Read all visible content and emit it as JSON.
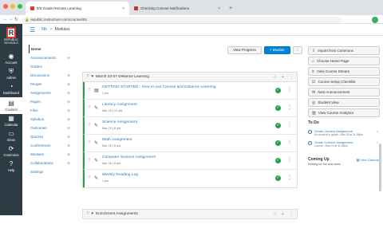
{
  "browser": {
    "tabs": [
      {
        "label": "8/3 Grade Remote Learning",
        "active": true
      },
      {
        "label": "Checking Canvas Notifications",
        "active": false
      }
    ],
    "url": "republic.instructure.com/courses/61"
  },
  "global_nav": {
    "logo_text": "REPUBLIC SCHOOLS",
    "items": [
      {
        "label": "Account",
        "icon": "user-icon"
      },
      {
        "label": "Admin",
        "icon": "shield-icon"
      },
      {
        "label": "Dashboard",
        "icon": "dashboard-icon"
      },
      {
        "label": "Courses",
        "icon": "book-icon",
        "active": true
      },
      {
        "label": "Calendar",
        "icon": "calendar-icon"
      },
      {
        "label": "Inbox",
        "icon": "inbox-icon"
      },
      {
        "label": "Commons",
        "icon": "commons-icon"
      },
      {
        "label": "Help",
        "icon": "help-icon"
      }
    ]
  },
  "breadcrumb": {
    "course": "5th",
    "separator": ">",
    "current": "Modules"
  },
  "course_nav": [
    {
      "label": "Home",
      "active": true
    },
    {
      "label": "Announcements",
      "hidden": true
    },
    {
      "label": "Grades"
    },
    {
      "label": "Discussions",
      "hidden": true
    },
    {
      "label": "People",
      "hidden": true
    },
    {
      "label": "Assignments",
      "hidden": true
    },
    {
      "label": "Pages",
      "hidden": true
    },
    {
      "label": "Files",
      "hidden": true
    },
    {
      "label": "Syllabus",
      "hidden": true
    },
    {
      "label": "Outcomes",
      "hidden": true
    },
    {
      "label": "Quizzes",
      "hidden": true
    },
    {
      "label": "Conferences",
      "hidden": true
    },
    {
      "label": "Modules",
      "hidden": true
    },
    {
      "label": "Collaborations",
      "hidden": true
    },
    {
      "label": "Settings"
    }
  ],
  "toolbar": {
    "view_progress": "View Progress",
    "add_module": "+ Module",
    "more": "⋮"
  },
  "modules": [
    {
      "title": "March 23-27 Distance Learning",
      "items": [
        {
          "title": "GETTING STARTED - How to use Canvas and Distance Learning",
          "meta": "1 pts",
          "icon": "page-icon"
        },
        {
          "title": "Literacy Assignment",
          "meta": "Mar 23 | 10 pts",
          "icon": "assignment-icon"
        },
        {
          "title": "Science Assignment",
          "meta": "Mar 24 | 8 pts",
          "icon": "assignment-icon"
        },
        {
          "title": "Math Assignment",
          "meta": "Mar 25 | 8 pts",
          "icon": "assignment-icon"
        },
        {
          "title": "Computer Science Assignment",
          "meta": "Mar 26 | 8 pts",
          "icon": "assignment-icon"
        },
        {
          "title": "Weekly Reading Log",
          "meta": "1 pts",
          "icon": "assignment-icon"
        }
      ]
    },
    {
      "title": "Enrichment Assignments",
      "items": []
    }
  ],
  "sidebar": {
    "buttons": [
      {
        "label": "Import from Commons",
        "icon": "import-icon"
      },
      {
        "label": "Choose Home Page",
        "icon": "home-icon"
      },
      {
        "label": "View Course Stream",
        "icon": "stream-icon"
      },
      {
        "label": "Course Setup Checklist",
        "icon": "checklist-icon"
      },
      {
        "label": "New Announcement",
        "icon": "announcement-icon"
      },
      {
        "label": "Student View",
        "icon": "student-view-icon"
      },
      {
        "label": "View Course Analytics",
        "icon": "analytics-icon"
      }
    ],
    "todo_title": "To Do",
    "todos": [
      {
        "title": "Grade Literacy Assignment",
        "detail": "No student to grade • Mar 23 at 11:59pm"
      },
      {
        "title": "Grade Science Assignment",
        "detail": "Course • Mar 24 at 11:59pm"
      }
    ],
    "coming_up_title": "Coming Up",
    "view_calendar": "View Calendar",
    "nothing": "Nothing for the next week"
  }
}
